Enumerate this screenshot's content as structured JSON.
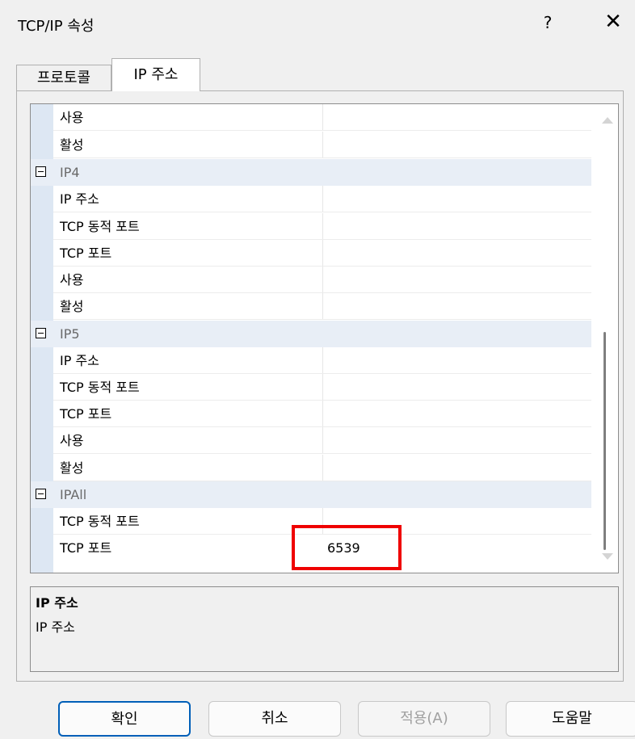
{
  "window": {
    "title": "TCP/IP 속성",
    "help": "?",
    "close": "✕"
  },
  "tabs": [
    {
      "label": "프로토콜"
    },
    {
      "label": "IP 주소"
    }
  ],
  "grid": {
    "rows": [
      {
        "type": "prop",
        "name": "사용"
      },
      {
        "type": "prop",
        "name": "활성"
      },
      {
        "type": "cat",
        "name": "IP4"
      },
      {
        "type": "prop",
        "name": "IP 주소"
      },
      {
        "type": "prop",
        "name": "TCP 동적 포트"
      },
      {
        "type": "prop",
        "name": "TCP 포트"
      },
      {
        "type": "prop",
        "name": "사용"
      },
      {
        "type": "prop",
        "name": "활성"
      },
      {
        "type": "cat",
        "name": "IP5"
      },
      {
        "type": "prop",
        "name": "IP 주소"
      },
      {
        "type": "prop",
        "name": "TCP 동적 포트"
      },
      {
        "type": "prop",
        "name": "TCP 포트"
      },
      {
        "type": "prop",
        "name": "사용"
      },
      {
        "type": "prop",
        "name": "활성"
      },
      {
        "type": "cat",
        "name": "IPAll"
      },
      {
        "type": "prop",
        "name": "TCP 동적 포트"
      },
      {
        "type": "prop",
        "name": "TCP 포트",
        "value": "6539"
      }
    ]
  },
  "description": {
    "title": "IP 주소",
    "text": "IP 주소"
  },
  "buttons": {
    "ok": "확인",
    "cancel": "취소",
    "apply": "적용(A)",
    "help": "도움말"
  },
  "colors": {
    "highlight": "#ef0000",
    "primary_border": "#005fb8",
    "category_bg": "#e8eef6"
  }
}
